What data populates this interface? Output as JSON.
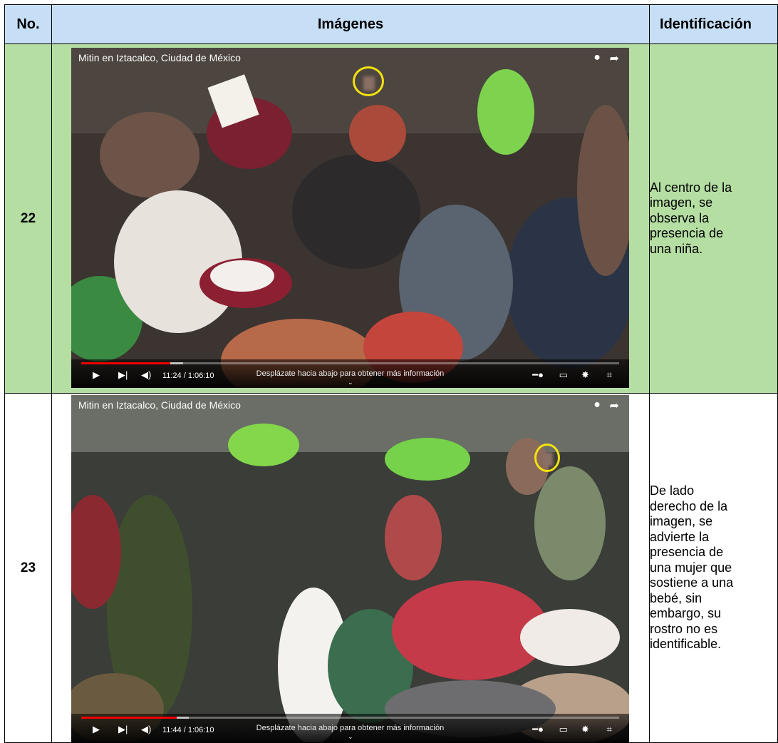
{
  "table": {
    "headers": {
      "no": "No.",
      "images": "Imágenes",
      "identification": "Identificación"
    },
    "rows": [
      {
        "no": "22",
        "video": {
          "title": "Mitin en Iztacalco, Ciudad de México",
          "time": "11:24 / 1:06:10",
          "hint": "Desplázate hacia abajo para obtener más información",
          "progress": 0.166,
          "buffered": 0.19
        },
        "identification": [
          "Al centro de la",
          "imagen, se",
          "observa la",
          "presencia de",
          "una niña."
        ]
      },
      {
        "no": "23",
        "video": {
          "title": "Mitin en Iztacalco, Ciudad de México",
          "time": "11:44 / 1:06:10",
          "hint": "Desplázate hacia abajo para obtener más información",
          "progress": 0.177,
          "buffered": 0.2
        },
        "identification": [
          "De lado",
          "derecho de la",
          "imagen, se",
          "advierte la",
          "presencia de",
          "una mujer que",
          "sostiene a una",
          "bebé, sin",
          "embargo, su",
          "rostro no es",
          "identificable."
        ]
      }
    ]
  },
  "icons": [
    "clock-icon",
    "share-icon",
    "play-icon",
    "next-icon",
    "volume-icon",
    "autoplay-toggle-icon",
    "subtitles-icon",
    "settings-icon",
    "fullscreen-exit-icon",
    "chevron-down-icon"
  ],
  "colors": {
    "header_bg": "#c6dff6",
    "highlight_bg": "#b5dea3",
    "progress_red": "#e00000",
    "marker_yellow": "#f3e10e"
  }
}
